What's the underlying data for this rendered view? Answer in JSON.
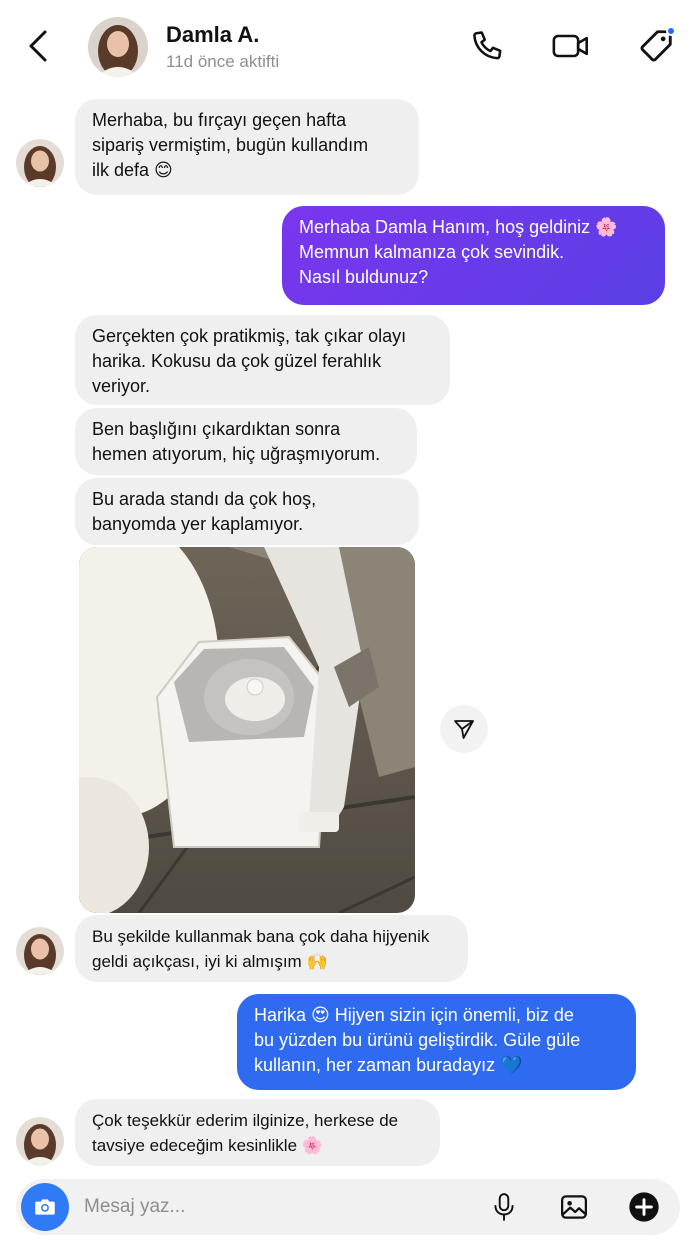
{
  "header": {
    "name": "Damla A.",
    "status": "11d önce aktifti"
  },
  "messages": [
    {
      "from": "them",
      "text": "Merhaba, bu fırçayı geçen hafta\nsipariş vermiştim, bugün kullandım\nilk defa 😊"
    },
    {
      "from": "me",
      "text": "Merhaba Damla Hanım, hoş geldiniz 🌸\nMemnun kalmanıza çok sevindik.\nNasıl buldunuz?"
    },
    {
      "from": "them",
      "text": "Gerçekten çok pratikmiş, tak çıkar olayı\nharika. Kokusu da çok güzel ferahlık\nveriyor."
    },
    {
      "from": "them",
      "text": "Ben başlığını çıkardıktan sonra\nhemen atıyorum, hiç uğraşmıyorum."
    },
    {
      "from": "them",
      "text": "Bu arada standı da çok hoş,\nbanyomda yer kaplamıyor."
    },
    {
      "from": "them",
      "text": "Bu şekilde kullanmak bana çok daha hijyenik\ngeldi açıkçası, iyi ki almışım 🙌"
    },
    {
      "from": "me",
      "text": "Harika 😍 Hijyen sizin için önemli, biz de\nbu yüzden bu ürünü geliştirdik. Güle güle\nkullanın, her zaman buradayız 💙"
    },
    {
      "from": "them",
      "text": "Çok teşekkür ederim ilginize, herkese de\ntavsiye edeceğim kesinlikle 🌸"
    }
  ],
  "composer": {
    "placeholder": "Mesaj yaz..."
  },
  "colors": {
    "outgoing_purple": "#6a3aea",
    "outgoing_blue": "#2f6bf0",
    "incoming": "#efefef",
    "camera": "#2f7bf6"
  }
}
